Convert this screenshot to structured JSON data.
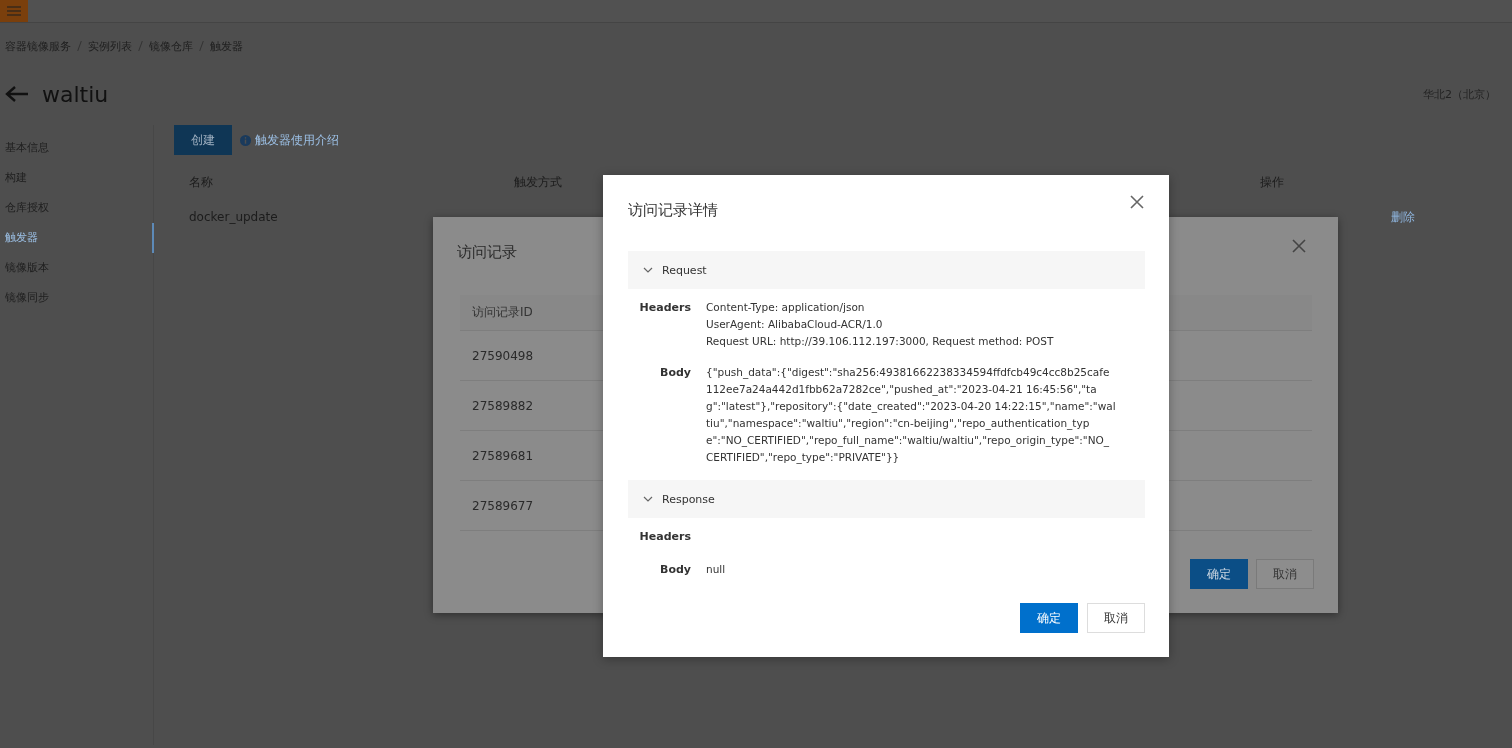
{
  "breadcrumb": [
    "容器镜像服务",
    "实例列表",
    "镜像仓库",
    "触发器"
  ],
  "page": {
    "title": "waltiu",
    "region": "华北2（北京）"
  },
  "sidebar": [
    {
      "label": "基本信息",
      "selected": false
    },
    {
      "label": "构建",
      "selected": false
    },
    {
      "label": "仓库授权",
      "selected": false
    },
    {
      "label": "触发器",
      "selected": true
    },
    {
      "label": "镜像版本",
      "selected": false
    },
    {
      "label": "镜像同步",
      "selected": false
    }
  ],
  "toolbar": {
    "create_button": "创建",
    "help_link": "触发器使用介绍"
  },
  "trigger_table": {
    "columns": [
      "名称",
      "触发方式",
      "操作"
    ],
    "rows": [
      {
        "name": "docker_update",
        "actions": [
          "删除"
        ]
      }
    ]
  },
  "records_dialog": {
    "title": "访问记录",
    "columns": [
      "访问记录ID"
    ],
    "rows": [
      "27590498",
      "27589882",
      "27589681",
      "27589677"
    ],
    "buttons": [
      {
        "label": "确定",
        "kind": "primary"
      },
      {
        "label": "取消",
        "kind": "secondary"
      }
    ]
  },
  "detail_dialog": {
    "title": "访问记录详情",
    "sections": [
      {
        "title": "Request",
        "expanded": true,
        "fields": [
          {
            "label": "Headers",
            "lines": [
              "Content-Type: application/json",
              "UserAgent: AlibabaCloud-ACR/1.0",
              "Request URL: http://39.106.112.197:3000, Request method: POST"
            ]
          },
          {
            "label": "Body",
            "lines": [
              "{\"push_data\":{\"digest\":\"sha256:49381662238334594ffdfcb49c4cc8b25cafe112ee7a24a442d1fbb62a7282ce\",\"pushed_at\":\"2023-04-21 16:45:56\",\"tag\":\"latest\"},\"repository\":{\"date_created\":\"2023-04-20 14:22:15\",\"name\":\"waltiu\",\"namespace\":\"waltiu\",\"region\":\"cn-beijing\",\"repo_authentication_type\":\"NO_CERTIFIED\",\"repo_full_name\":\"waltiu/waltiu\",\"repo_origin_type\":\"NO_CERTIFIED\",\"repo_type\":\"PRIVATE\"}}"
            ]
          }
        ]
      },
      {
        "title": "Response",
        "expanded": true,
        "fields": [
          {
            "label": "Headers"
          },
          {
            "label": "Body",
            "lines": [
              "null"
            ]
          }
        ]
      }
    ],
    "buttons": [
      {
        "label": "确定",
        "kind": "primary"
      },
      {
        "label": "取消",
        "kind": "secondary"
      }
    ]
  }
}
